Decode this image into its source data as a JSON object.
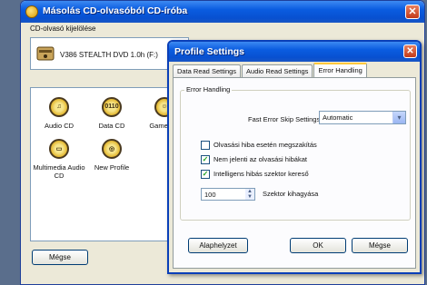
{
  "main_window": {
    "title": "Másolás CD-olvasóból CD-íróba",
    "close_label": "✕",
    "drive_section_label": "CD-olvasó kijelölése",
    "drive_name": "V386 STEALTH DVD 1.0h (F:)",
    "profiles": [
      {
        "label": "Audio CD",
        "icon": "♫"
      },
      {
        "label": "Data CD",
        "icon": "0110"
      },
      {
        "label": "Game CD",
        "icon": "☺"
      },
      {
        "label": "Multimedia Audio CD",
        "icon": "▭"
      },
      {
        "label": "New Profile",
        "icon": "◎"
      }
    ],
    "cancel_label": "Mégse"
  },
  "dialog": {
    "title": "Profile Settings",
    "close_label": "✕",
    "tabs": [
      {
        "label": "Data Read Settings",
        "active": false
      },
      {
        "label": "Audio Read Settings",
        "active": false
      },
      {
        "label": "Error Handling",
        "active": true
      }
    ],
    "group_label": "Error Handling",
    "fast_skip_label": "Fast Error Skip Settings:",
    "fast_skip_value": "Automatic",
    "checkboxes": [
      {
        "label": "Olvasási hiba esetén megszakítás",
        "checked": false
      },
      {
        "label": "Nem jelenti az olvasási hibákat",
        "checked": true
      },
      {
        "label": "Intelligens hibás szektor kereső",
        "checked": true
      }
    ],
    "sector_skip_value": "100",
    "sector_skip_label": "Szektor kihagyása",
    "default_button": "Alaphelyzet",
    "ok_button": "OK",
    "cancel_button": "Mégse"
  }
}
